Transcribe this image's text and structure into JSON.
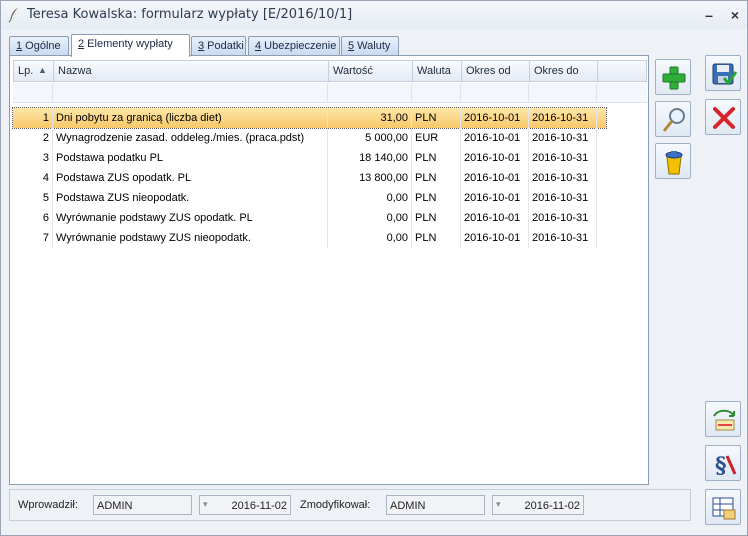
{
  "window": {
    "title": "Teresa Kowalska: formularz wypłaty [E/2016/10/1]",
    "minimize_label": "–",
    "close_label": "×"
  },
  "tabs": [
    {
      "key": "1",
      "label": " Ogólne"
    },
    {
      "key": "2",
      "label": " Elementy wypłaty"
    },
    {
      "key": "3",
      "label": " Podatki"
    },
    {
      "key": "4",
      "label": " Ubezpieczenie"
    },
    {
      "key": "5",
      "label": " Waluty"
    }
  ],
  "grid": {
    "headers": {
      "lp": "Lp.",
      "sort_indicator": "▲",
      "nazwa": "Nazwa",
      "wartosc": "Wartość",
      "waluta": "Waluta",
      "okres_od": "Okres od",
      "okres_do": "Okres do"
    },
    "rows": [
      {
        "lp": "1",
        "nazwa": "Dni pobytu za granicą (liczba diet)",
        "wartosc": "31,00",
        "waluta": "PLN",
        "od": "2016-10-01",
        "do": "2016-10-31"
      },
      {
        "lp": "2",
        "nazwa": "Wynagrodzenie zasad. oddeleg./mies. (praca.pdst)",
        "wartosc": "5 000,00",
        "waluta": "EUR",
        "od": "2016-10-01",
        "do": "2016-10-31"
      },
      {
        "lp": "3",
        "nazwa": "Podstawa podatku PL",
        "wartosc": "18 140,00",
        "waluta": "PLN",
        "od": "2016-10-01",
        "do": "2016-10-31"
      },
      {
        "lp": "4",
        "nazwa": "Podstawa ZUS opodatk. PL",
        "wartosc": "13 800,00",
        "waluta": "PLN",
        "od": "2016-10-01",
        "do": "2016-10-31"
      },
      {
        "lp": "5",
        "nazwa": "Podstawa ZUS nieopodatk.",
        "wartosc": "0,00",
        "waluta": "PLN",
        "od": "2016-10-01",
        "do": "2016-10-31"
      },
      {
        "lp": "6",
        "nazwa": "Wyrównanie podstawy ZUS opodatk. PL",
        "wartosc": "0,00",
        "waluta": "PLN",
        "od": "2016-10-01",
        "do": "2016-10-31"
      },
      {
        "lp": "7",
        "nazwa": "Wyrównanie podstawy ZUS nieopodatk.",
        "wartosc": "0,00",
        "waluta": "PLN",
        "od": "2016-10-01",
        "do": "2016-10-31"
      }
    ]
  },
  "footer": {
    "wprowadzil_label": "Wprowadził:",
    "wprowadzil_user": "ADMIN",
    "wprowadzil_date": "2016-11-02",
    "zmodyfikowal_label": "Zmodyfikował:",
    "zmodyfikowal_user": "ADMIN",
    "zmodyfikowal_date": "2016-11-02",
    "dropdown_glyph": "▾"
  },
  "side_buttons": [
    "add-icon",
    "magnifier-icon",
    "trash-icon",
    "save-icon",
    "cancel-icon",
    "recalculate-icon",
    "paragraph-icon",
    "table-icon"
  ]
}
